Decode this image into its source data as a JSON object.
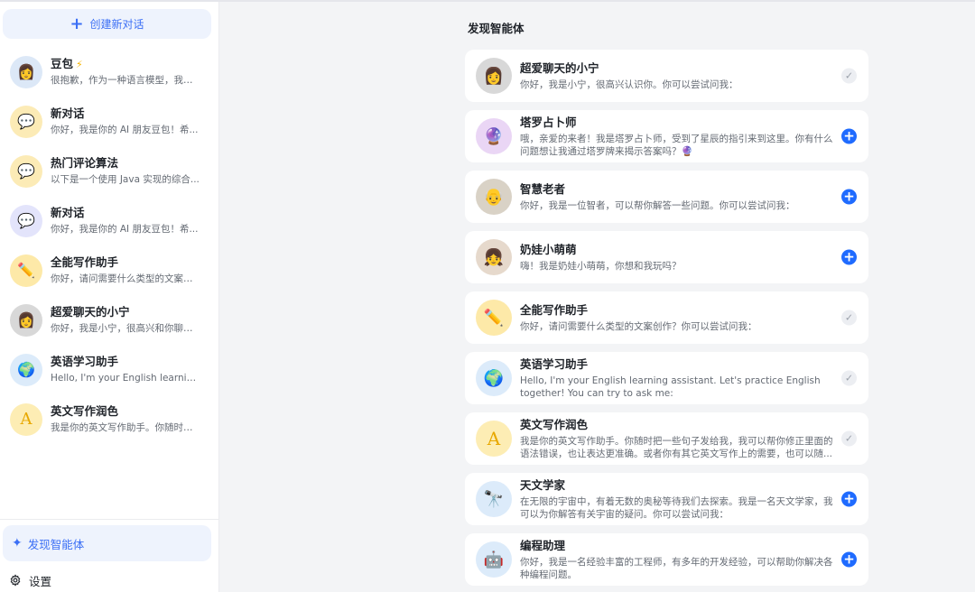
{
  "sidebar": {
    "new_chat_label": "创建新对话",
    "conversations": [
      {
        "title": "豆包",
        "badge": "⚡",
        "preview": "很抱歉，作为一种语言模型，我无...",
        "avatar_bg": "#dce8f7",
        "avatar_icon": "👩",
        "avatar_name": "doubao-avatar"
      },
      {
        "title": "新对话",
        "badge": "",
        "preview": "你好，我是你的 AI 朋友豆包！希...",
        "avatar_bg": "#fcebb6",
        "avatar_icon": "💬",
        "avatar_name": "chat-bubble-icon"
      },
      {
        "title": "热门评论算法",
        "badge": "",
        "preview": "以下是一个使用 Java 实现的综合...",
        "avatar_bg": "#fcebb6",
        "avatar_icon": "💬",
        "avatar_name": "chat-bubble-icon"
      },
      {
        "title": "新对话",
        "badge": "",
        "preview": "你好，我是你的 AI 朋友豆包！希...",
        "avatar_bg": "#e3e4fb",
        "avatar_icon": "💬",
        "avatar_name": "chat-bubble-icon"
      },
      {
        "title": "全能写作助手",
        "badge": "",
        "preview": "你好，请问需要什么类型的文案创...",
        "avatar_bg": "#fde9a8",
        "avatar_icon": "✏️",
        "avatar_name": "pencil-icon"
      },
      {
        "title": "超爱聊天的小宁",
        "badge": "",
        "preview": "你好，我是小宁，很高兴和你聊天...",
        "avatar_bg": "#d8d8d8",
        "avatar_icon": "👩",
        "avatar_name": "xiaoning-avatar"
      },
      {
        "title": "英语学习助手",
        "badge": "",
        "preview": "Hello, I'm your English learning a...",
        "avatar_bg": "#dcebfa",
        "avatar_icon": "🌍",
        "avatar_name": "globe-icon"
      },
      {
        "title": "英文写作润色",
        "badge": "",
        "preview": "我是你的英文写作助手。你随时把...",
        "avatar_bg": "#fdedb4",
        "avatar_icon": "A",
        "avatar_name": "text-a-icon"
      }
    ],
    "discover_label": "发现智能体",
    "settings_label": "设置"
  },
  "main": {
    "title": "发现智能体",
    "agents": [
      {
        "name": "超爱聊天的小宁",
        "desc": "你好，我是小宁，很高兴认识你。你可以尝试问我：",
        "added": true,
        "avatar_bg": "#d8d8d8",
        "avatar_icon": "👩",
        "avatar_name": "xiaoning-avatar"
      },
      {
        "name": "塔罗占卜师",
        "desc": "哦，亲爱的来者！我是塔罗占卜师，受到了星辰的指引来到这里。你有什么问题想让我通过塔罗牌来揭示答案吗？🔮",
        "added": false,
        "avatar_bg": "#ead6f5",
        "avatar_icon": "🔮",
        "avatar_name": "crystal-ball-icon"
      },
      {
        "name": "智慧老者",
        "desc": "你好，我是一位智者，可以帮你解答一些问题。你可以尝试问我：",
        "added": false,
        "avatar_bg": "#d9d2c6",
        "avatar_icon": "👴",
        "avatar_name": "elder-avatar"
      },
      {
        "name": "奶娃小萌萌",
        "desc": "嗨！我是奶娃小萌萌，你想和我玩吗？",
        "added": false,
        "avatar_bg": "#e6d9cc",
        "avatar_icon": "👧",
        "avatar_name": "child-avatar"
      },
      {
        "name": "全能写作助手",
        "desc": "你好，请问需要什么类型的文案创作？你可以尝试问我：",
        "added": true,
        "avatar_bg": "#fde9a8",
        "avatar_icon": "✏️",
        "avatar_name": "pencil-icon"
      },
      {
        "name": "英语学习助手",
        "desc": "Hello, I'm your English learning assistant. Let's practice English together! You can try to ask me:",
        "added": true,
        "avatar_bg": "#dcebfa",
        "avatar_icon": "🌍",
        "avatar_name": "globe-icon"
      },
      {
        "name": "英文写作润色",
        "desc": "我是你的英文写作助手。你随时把一些句子发给我，我可以帮你修正里面的语法错误，也让表达更准确。或者你有其它英文写作上的需要，也可以随...",
        "added": true,
        "avatar_bg": "#fdedb4",
        "avatar_icon": "A",
        "avatar_name": "text-a-icon"
      },
      {
        "name": "天文学家",
        "desc": "在无限的宇宙中，有着无数的奥秘等待我们去探索。我是一名天文学家，我可以为你解答有关宇宙的疑问。你可以尝试问我：",
        "added": false,
        "avatar_bg": "#dcebfa",
        "avatar_icon": "🔭",
        "avatar_name": "telescope-icon"
      },
      {
        "name": "编程助理",
        "desc": "你好，我是一名经验丰富的工程师，有多年的开发经验，可以帮助你解决各种编程问题。",
        "added": false,
        "avatar_bg": "#dcebfa",
        "avatar_icon": "🤖",
        "avatar_name": "robot-icon"
      }
    ]
  },
  "colors": {
    "accent": "#1f6bff",
    "nav_highlight": "#eef3fd",
    "page_bg": "#f3f4f6"
  }
}
